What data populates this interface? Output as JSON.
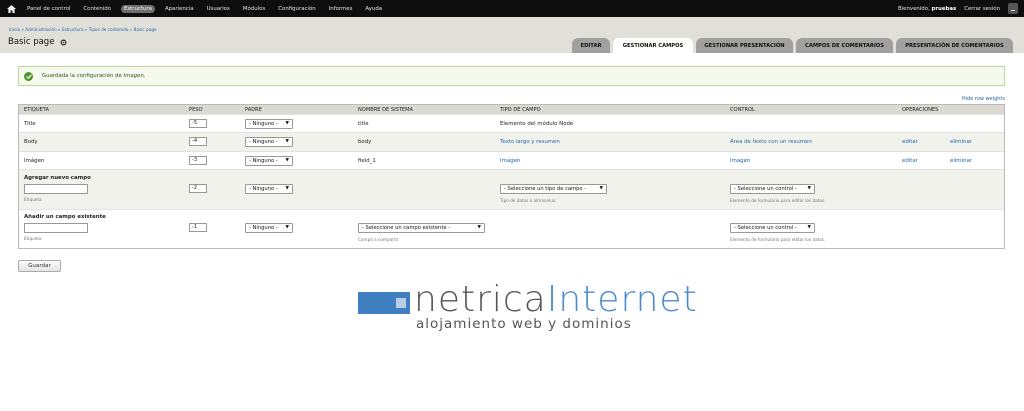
{
  "toolbar": {
    "items": [
      "Panel de control",
      "Contenido",
      "Estructura",
      "Apariencia",
      "Usuarios",
      "Módulos",
      "Configuración",
      "Informes",
      "Ayuda"
    ],
    "welcome_prefix": "Bienvenido,",
    "username": "pruebas",
    "logout": "Cerrar sesión"
  },
  "header": {
    "breadcrumb": "Inicio » Administración » Estructura » Tipos de contenido » Basic page",
    "title": "Basic page",
    "tabs": [
      "EDITAR",
      "GESTIONAR CAMPOS",
      "GESTIONAR PRESENTACIÓN",
      "CAMPOS DE COMENTARIOS",
      "PRESENTACIÓN DE COMENTARIOS"
    ]
  },
  "message": {
    "prefix": "Guardada la configuración de ",
    "field": "Imagen",
    "suffix": "."
  },
  "hide_weights": "Hide row weights",
  "table": {
    "headers": [
      "ETIQUETA",
      "PESO",
      "PADRE",
      "NOMBRE DE SISTEMA",
      "TIPO DE CAMPO",
      "CONTROL",
      "OPERACIONES"
    ],
    "rows": [
      {
        "label": "Title",
        "weight": "-5",
        "parent": "- Ninguno -",
        "machine": "title",
        "type": "Elemento del módulo Node",
        "widget": "",
        "edit": "",
        "delete": ""
      },
      {
        "label": "Body",
        "weight": "-4",
        "parent": "- Ninguno -",
        "machine": "body",
        "type": "Texto largo y resumen",
        "widget": "Área de texto con un resumen",
        "edit": "editar",
        "delete": "eliminar"
      },
      {
        "label": "Imágen",
        "weight": "-3",
        "parent": "- Ninguno -",
        "machine": "field_1",
        "type": "Imagen",
        "widget": "Imagen",
        "edit": "editar",
        "delete": "eliminar"
      }
    ],
    "add_new": {
      "title": "Agregar nuevo campo",
      "label_desc": "Etiqueta",
      "weight": "-2",
      "parent": "- Ninguno -",
      "type_select": "- Seleccione un tipo de campo -",
      "type_desc": "Tipo de datos a almacenar.",
      "widget_select": "- Seleccione un control -",
      "widget_desc": "Elemento de formulario para editar los datos."
    },
    "add_existing": {
      "title": "Añadir un campo existente",
      "label_desc": "Etiqueta",
      "weight": "-1",
      "parent": "- Ninguno -",
      "field_select": "- Seleccione un campo existente -",
      "field_desc": "Campo a compartir",
      "widget_select": "- Seleccione un control -",
      "widget_desc": "Elemento de formulario para editar los datos."
    }
  },
  "save_label": "Guardar",
  "logo": {
    "word_a": "netrica",
    "word_b": "Internet",
    "tagline": "alojamiento web y dominios"
  }
}
